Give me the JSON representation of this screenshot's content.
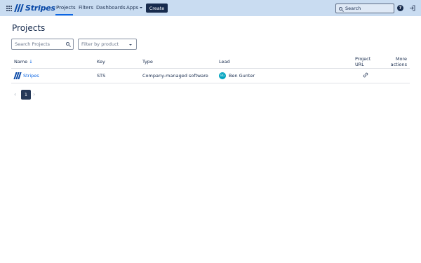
{
  "topbar": {
    "logo_text": "Stripes",
    "nav": [
      "Projects",
      "Filters",
      "Dashboards",
      "Apps"
    ],
    "create_label": "Create",
    "search_placeholder": "Search",
    "help_label": "?",
    "icons": [
      "app-switcher-icon",
      "caret-down-icon",
      "search-icon",
      "help-icon",
      "logout-icon"
    ]
  },
  "page": {
    "title": "Projects",
    "search_placeholder": "Search Projects",
    "product_filter_placeholder": "Filter by product"
  },
  "table": {
    "headers": {
      "name": "Name",
      "sort_indicator": "↓",
      "key": "Key",
      "type": "Type",
      "lead": "Lead",
      "project_url_line1": "Project",
      "project_url_line2": "URL",
      "more_actions_line1": "More",
      "more_actions_line2": "actions"
    },
    "rows": [
      {
        "name": "Stripes",
        "key": "STS",
        "type": "Company-managed software",
        "lead_initials": "BG",
        "lead": "Ben Gunter"
      }
    ]
  },
  "pagination": {
    "prev": "‹",
    "current": "1",
    "next": "›"
  },
  "colors": {
    "topbar_bg": "#c9dcf1",
    "brand": "#0747a6",
    "link": "#0c66e4",
    "create_button": "#172b4d",
    "avatar": "#00a3bf"
  }
}
